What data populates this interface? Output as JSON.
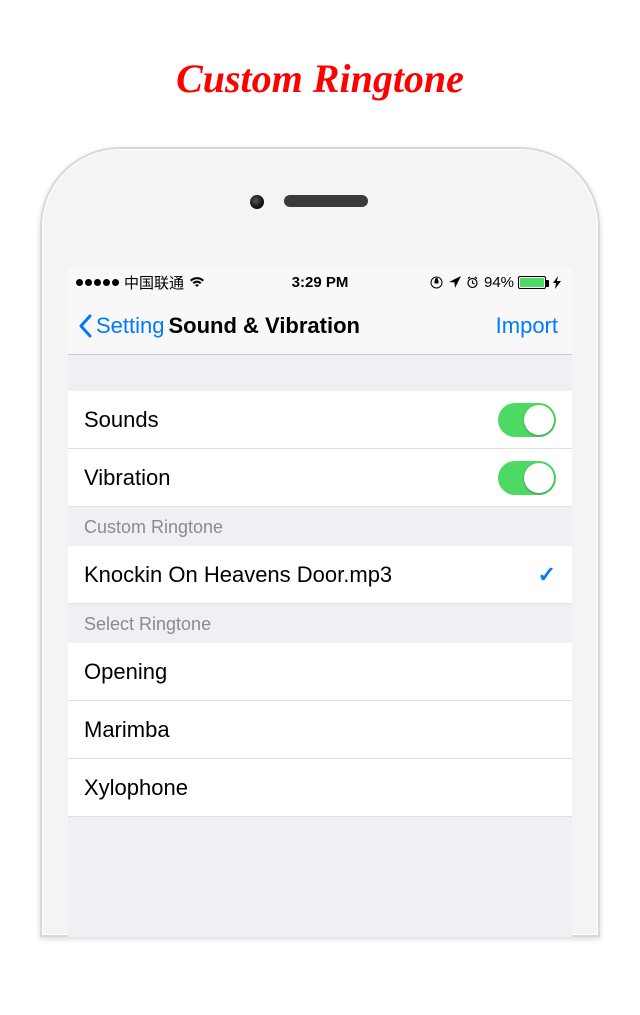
{
  "page": {
    "banner_title": "Custom Ringtone"
  },
  "statusbar": {
    "carrier": "中国联通",
    "time": "3:29 PM",
    "battery_pct": "94%"
  },
  "nav": {
    "back_label": "Setting",
    "title": "Sound & Vibration",
    "right_label": "Import"
  },
  "toggles": {
    "sounds_label": "Sounds",
    "sounds_on": true,
    "vibration_label": "Vibration",
    "vibration_on": true
  },
  "custom_ringtone": {
    "header": "Custom Ringtone",
    "selected": "Knockin On Heavens Door.mp3"
  },
  "select_ringtone": {
    "header": "Select Ringtone",
    "items": [
      "Opening",
      "Marimba",
      "Xylophone"
    ]
  }
}
